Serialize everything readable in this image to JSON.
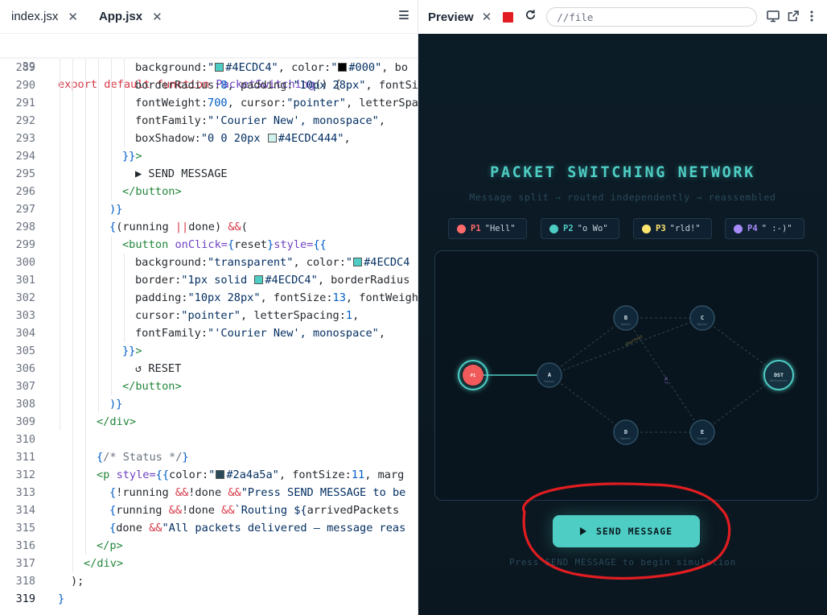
{
  "editor": {
    "tabs": [
      {
        "label": "index.jsx",
        "active": false
      },
      {
        "label": "App.jsx",
        "active": true
      }
    ],
    "sticky_line": {
      "num": "39",
      "text": "export default function PacketSwitching() {"
    },
    "lines": [
      {
        "num": "289",
        "tokens": [
          [
            "p",
            "    background:"
          ],
          [
            "s",
            "\""
          ],
          [
            "sw",
            "#4ECDC4"
          ],
          [
            "s",
            "#4ECDC4\""
          ],
          [
            "p",
            ", color:"
          ],
          [
            "s",
            "\""
          ],
          [
            "sw",
            "#000"
          ],
          [
            "s",
            "#000\""
          ],
          [
            "p",
            ", bo"
          ]
        ]
      },
      {
        "num": "290",
        "tokens": [
          [
            "p",
            "    borderRadius:"
          ],
          [
            "n",
            "8"
          ],
          [
            "p",
            ", padding:"
          ],
          [
            "s",
            "\"10px 28px\""
          ],
          [
            "p",
            ", fontSi"
          ]
        ]
      },
      {
        "num": "291",
        "tokens": [
          [
            "p",
            "    fontWeight:"
          ],
          [
            "n",
            "700"
          ],
          [
            "p",
            ", cursor:"
          ],
          [
            "s",
            "\"pointer\""
          ],
          [
            "p",
            ", letterSpa"
          ]
        ]
      },
      {
        "num": "292",
        "tokens": [
          [
            "p",
            "    fontFamily:"
          ],
          [
            "s",
            "\"'Courier New', monospace\""
          ],
          [
            "p",
            ","
          ]
        ]
      },
      {
        "num": "293",
        "tokens": [
          [
            "p",
            "    boxShadow:"
          ],
          [
            "s",
            "\"0 0 20px "
          ],
          [
            "sw",
            "#4ECDC444"
          ],
          [
            "s",
            "#4ECDC444\""
          ],
          [
            "p",
            ","
          ]
        ]
      },
      {
        "num": "294",
        "tokens": [
          [
            "p",
            "  "
          ],
          [
            "n",
            "}}"
          ],
          [
            "t",
            ">"
          ]
        ]
      },
      {
        "num": "295",
        "tokens": [
          [
            "p",
            "    ▶ SEND MESSAGE"
          ]
        ]
      },
      {
        "num": "296",
        "tokens": [
          [
            "p",
            "  "
          ],
          [
            "t",
            "</button>"
          ]
        ]
      },
      {
        "num": "297",
        "tokens": [
          [
            "n",
            ")}"
          ]
        ]
      },
      {
        "num": "298",
        "tokens": [
          [
            "n",
            "{"
          ],
          [
            "p",
            "(running "
          ],
          [
            "k",
            "||"
          ],
          [
            "p",
            " done) "
          ],
          [
            "k",
            "&&"
          ],
          [
            "p",
            " ("
          ]
        ]
      },
      {
        "num": "299",
        "tokens": [
          [
            "p",
            "  "
          ],
          [
            "t",
            "<button "
          ],
          [
            "a",
            "onClick="
          ],
          [
            "n",
            "{"
          ],
          [
            "p",
            "reset"
          ],
          [
            "n",
            "}"
          ],
          [
            "a",
            " style="
          ],
          [
            "n",
            "{{"
          ]
        ]
      },
      {
        "num": "300",
        "tokens": [
          [
            "p",
            "    background:"
          ],
          [
            "s",
            "\"transparent\""
          ],
          [
            "p",
            ", color:"
          ],
          [
            "s",
            "\""
          ],
          [
            "sw",
            "#4ECDC4"
          ],
          [
            "s",
            "#4ECDC4"
          ]
        ]
      },
      {
        "num": "301",
        "tokens": [
          [
            "p",
            "    border:"
          ],
          [
            "s",
            "\"1px solid "
          ],
          [
            "sw",
            "#4ECDC4"
          ],
          [
            "s",
            "#4ECDC4\""
          ],
          [
            "p",
            ", borderRadius"
          ]
        ]
      },
      {
        "num": "302",
        "tokens": [
          [
            "p",
            "    padding:"
          ],
          [
            "s",
            "\"10px 28px\""
          ],
          [
            "p",
            ", fontSize:"
          ],
          [
            "n",
            "13"
          ],
          [
            "p",
            ", fontWeigh"
          ]
        ]
      },
      {
        "num": "303",
        "tokens": [
          [
            "p",
            "    cursor:"
          ],
          [
            "s",
            "\"pointer\""
          ],
          [
            "p",
            ", letterSpacing:"
          ],
          [
            "n",
            "1"
          ],
          [
            "p",
            ","
          ]
        ]
      },
      {
        "num": "304",
        "tokens": [
          [
            "p",
            "    fontFamily:"
          ],
          [
            "s",
            "\"'Courier New', monospace\""
          ],
          [
            "p",
            ","
          ]
        ]
      },
      {
        "num": "305",
        "tokens": [
          [
            "p",
            "  "
          ],
          [
            "n",
            "}}"
          ],
          [
            "t",
            ">"
          ]
        ]
      },
      {
        "num": "306",
        "tokens": [
          [
            "p",
            "    ↺ RESET"
          ]
        ]
      },
      {
        "num": "307",
        "tokens": [
          [
            "p",
            "  "
          ],
          [
            "t",
            "</button>"
          ]
        ]
      },
      {
        "num": "308",
        "tokens": [
          [
            "n",
            ")}"
          ]
        ]
      },
      {
        "num": "309",
        "tokens": [
          [
            "t",
            "</div>"
          ]
        ]
      },
      {
        "num": "310",
        "tokens": []
      },
      {
        "num": "311",
        "tokens": [
          [
            "n",
            "{"
          ],
          [
            "c",
            "/* Status */"
          ],
          [
            "n",
            "}"
          ]
        ]
      },
      {
        "num": "312",
        "tokens": [
          [
            "t",
            "<p "
          ],
          [
            "a",
            "style="
          ],
          [
            "n",
            "{{"
          ],
          [
            "p",
            " color:"
          ],
          [
            "s",
            "\""
          ],
          [
            "sw",
            "#2a4a5a"
          ],
          [
            "s",
            "#2a4a5a\""
          ],
          [
            "p",
            ", fontSize:"
          ],
          [
            "n",
            "11"
          ],
          [
            "p",
            ", marg"
          ]
        ]
      },
      {
        "num": "313",
        "tokens": [
          [
            "n",
            "{"
          ],
          [
            "p",
            "!running "
          ],
          [
            "k",
            "&&"
          ],
          [
            "p",
            " !done "
          ],
          [
            "k",
            "&&"
          ],
          [
            "s",
            " \"Press SEND MESSAGE to be"
          ]
        ]
      },
      {
        "num": "314",
        "tokens": [
          [
            "n",
            "{"
          ],
          [
            "p",
            "running "
          ],
          [
            "k",
            "&&"
          ],
          [
            "p",
            " !done "
          ],
          [
            "k",
            "&&"
          ],
          [
            "s",
            " `Routing ${"
          ],
          [
            "p",
            "arrivedPackets"
          ]
        ]
      },
      {
        "num": "315",
        "tokens": [
          [
            "n",
            "{"
          ],
          [
            "p",
            "done "
          ],
          [
            "k",
            "&&"
          ],
          [
            "s",
            " \"All packets delivered — message reas"
          ]
        ]
      },
      {
        "num": "316",
        "tokens": [
          [
            "t",
            "</p>"
          ]
        ]
      },
      {
        "num": "317",
        "tokens": [
          [
            "t",
            "</div>"
          ]
        ]
      },
      {
        "num": "318",
        "tokens": [
          [
            "p",
            ");"
          ]
        ]
      },
      {
        "num": "319",
        "tokens": [
          [
            "n",
            "}"
          ]
        ]
      }
    ]
  },
  "preview": {
    "title": "Preview",
    "url": "//file",
    "app": {
      "title": "PACKET SWITCHING NETWORK",
      "subtitle": "Message split → routed independently → reassembled",
      "packets": [
        {
          "id": "P1",
          "text": "\"Hell\"",
          "color": "#ff6b6b"
        },
        {
          "id": "P2",
          "text": "\"o Wo\"",
          "color": "#4ecdc4"
        },
        {
          "id": "P3",
          "text": "\"rld!\"",
          "color": "#ffe66d"
        },
        {
          "id": "P4",
          "text": "\" :-)\"",
          "color": "#a78bfa"
        }
      ],
      "nodes": [
        {
          "id": "P1",
          "sub": ""
        },
        {
          "id": "A",
          "sub": "Router"
        },
        {
          "id": "B",
          "sub": "Router"
        },
        {
          "id": "C",
          "sub": "Router"
        },
        {
          "id": "D",
          "sub": "Router"
        },
        {
          "id": "E",
          "sub": "Router"
        },
        {
          "id": "DST",
          "sub": "Destination"
        }
      ],
      "edge_labels": [
        "shortest",
        "ALT"
      ],
      "send_label": "SEND MESSAGE",
      "status": "Press SEND MESSAGE to begin simulation"
    }
  },
  "colors": {
    "accent": "#4ECDC4",
    "background": "#0c1c27",
    "annotation": "#e11d21"
  }
}
